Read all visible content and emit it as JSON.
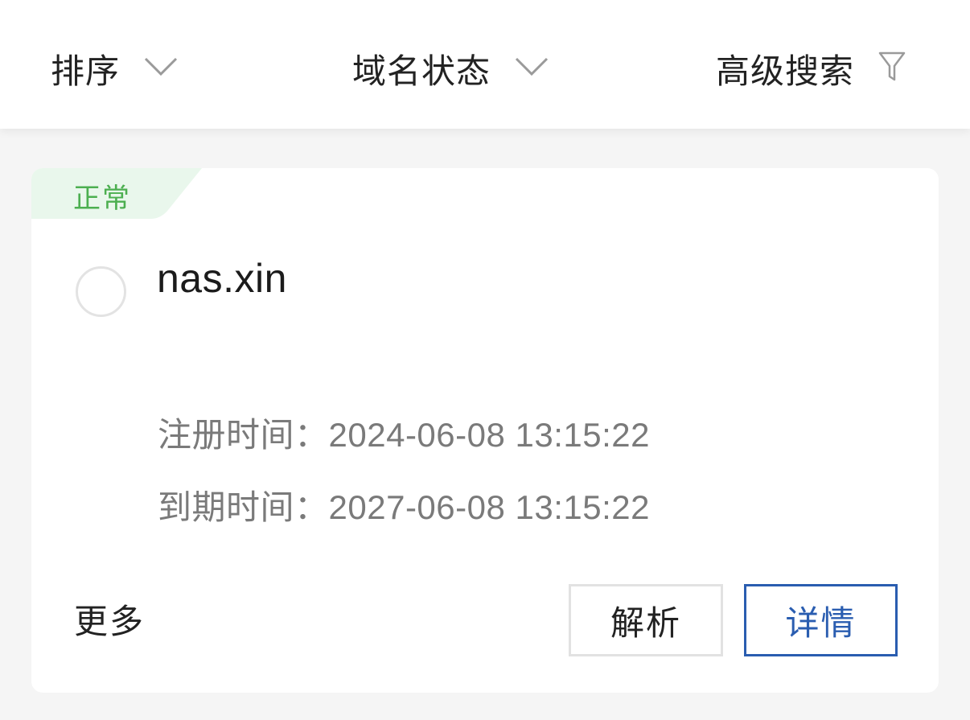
{
  "filter_bar": {
    "sort_label": "排序",
    "status_label": "域名状态",
    "advanced_label": "高级搜索"
  },
  "domain_card": {
    "status": "正常",
    "domain": "nas.xin",
    "registered_label": "注册时间：",
    "registered_value": "2024-06-08 13:15:22",
    "expires_label": "到期时间：",
    "expires_value": "2027-06-08 13:15:22",
    "more_label": "更多",
    "resolve_label": "解析",
    "detail_label": "详情"
  },
  "colors": {
    "status_green": "#4caf50",
    "status_bg": "#e9f7ec",
    "primary_blue": "#2a5db0"
  }
}
